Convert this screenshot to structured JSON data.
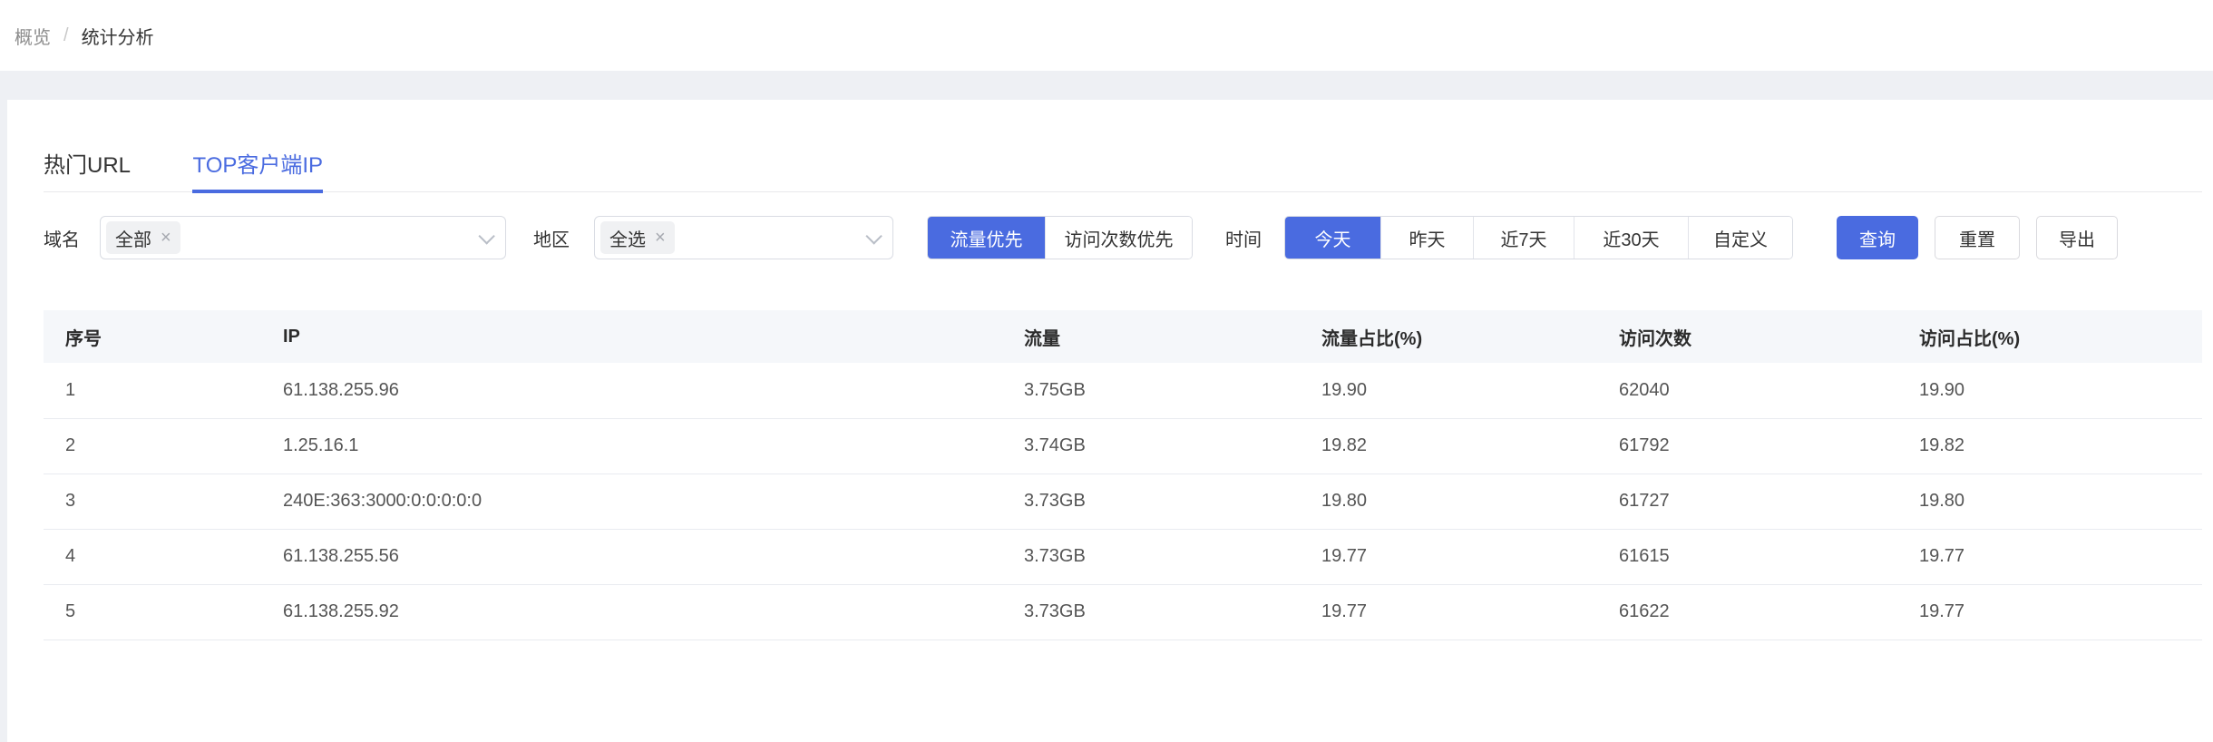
{
  "breadcrumb": {
    "parent": "概览",
    "separator": "/",
    "current": "统计分析"
  },
  "tabs": {
    "hot_url": "热门URL",
    "top_client_ip": "TOP客户端IP",
    "active_tab": "TOP客户端IP"
  },
  "filters": {
    "domain": {
      "label": "域名",
      "selected_tag": "全部",
      "remove_icon": "×"
    },
    "region": {
      "label": "地区",
      "selected_tag": "全选",
      "remove_icon": "×"
    },
    "sort": {
      "traffic": "流量优先",
      "visits": "访问次数优先",
      "active": "流量优先"
    },
    "time": {
      "label": "时间",
      "options": [
        "今天",
        "昨天",
        "近7天",
        "近30天",
        "自定义"
      ],
      "active": "今天"
    },
    "actions": {
      "query": "查询",
      "reset": "重置",
      "export": "导出"
    }
  },
  "table": {
    "columns": [
      "序号",
      "IP",
      "流量",
      "流量占比(%)",
      "访问次数",
      "访问占比(%)"
    ],
    "rows": [
      [
        "1",
        "61.138.255.96",
        "3.75GB",
        "19.90",
        "62040",
        "19.90"
      ],
      [
        "2",
        "1.25.16.1",
        "3.74GB",
        "19.82",
        "61792",
        "19.82"
      ],
      [
        "3",
        "240E:363:3000:0:0:0:0:0",
        "3.73GB",
        "19.80",
        "61727",
        "19.80"
      ],
      [
        "4",
        "61.138.255.56",
        "3.73GB",
        "19.77",
        "61615",
        "19.77"
      ],
      [
        "5",
        "61.138.255.92",
        "3.73GB",
        "19.77",
        "61622",
        "19.77"
      ]
    ]
  },
  "colors": {
    "primary": "#4a6be0",
    "page_bg": "#eef0f4",
    "table_header_bg": "#f5f7fa",
    "control_border": "#d9dce3",
    "row_border": "#e9ebf0"
  }
}
